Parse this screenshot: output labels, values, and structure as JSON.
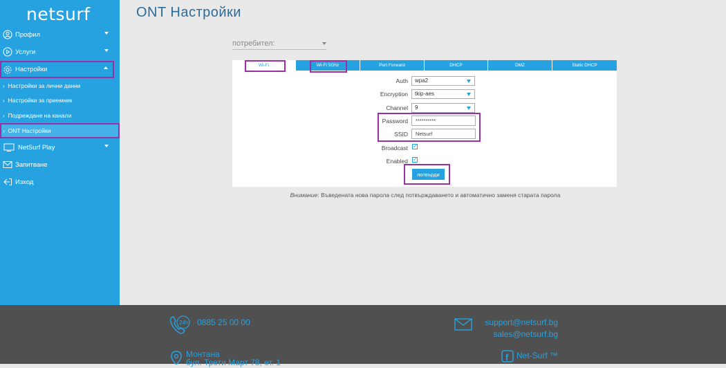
{
  "brand": {
    "logo": "netsurf"
  },
  "page": {
    "title": "ONT Настройки"
  },
  "sidebar": {
    "items": [
      {
        "label": "Профил"
      },
      {
        "label": "Услуги"
      },
      {
        "label": "Настройки"
      },
      {
        "label": "NetSurf Play"
      },
      {
        "label": "Запитване"
      },
      {
        "label": "Изход"
      }
    ],
    "subitems": [
      {
        "label": "Настройки за лични данни"
      },
      {
        "label": "Настройки за приемник"
      },
      {
        "label": "Подреждане на канали"
      },
      {
        "label": "ONT Настройки"
      }
    ]
  },
  "user_select": {
    "placeholder": "потребител:"
  },
  "tabs": [
    {
      "label": "Wi-Fi"
    },
    {
      "label": "Wi-Fi 5Ghz"
    },
    {
      "label": "Port Forward"
    },
    {
      "label": "DHCP"
    },
    {
      "label": "DMZ"
    },
    {
      "label": "Static DHCP"
    }
  ],
  "form": {
    "auth_label": "Auth",
    "auth_value": "wpa2",
    "encryption_label": "Encryption",
    "encryption_value": "tkip-aes",
    "channel_label": "Channel",
    "channel_value": "9",
    "password_label": "Password",
    "password_value": "**********",
    "ssid_label": "SSID",
    "ssid_value": "Netsurf",
    "broadcast_label": "Broadcast",
    "broadcast_checked": true,
    "enabled_label": "Enabled",
    "enabled_checked": true,
    "submit_label": "потвърди"
  },
  "notice": {
    "prefix": "Внимание",
    "text": ": Въведената нова парола след потвърждаването и автоматично заменя старата парола"
  },
  "footer": {
    "phone": "0885 25 00 00",
    "email_support": "support@netsurf.bg",
    "email_sales": "sales@netsurf.bg",
    "address_line1": "Монтана",
    "address_line2": "бул. Трети Март 78, ет. 1",
    "facebook": "Net-Surf ™"
  },
  "colors": {
    "accent": "#27a2e0",
    "highlight": "#9a2fa6",
    "footer_bg": "#505050"
  }
}
